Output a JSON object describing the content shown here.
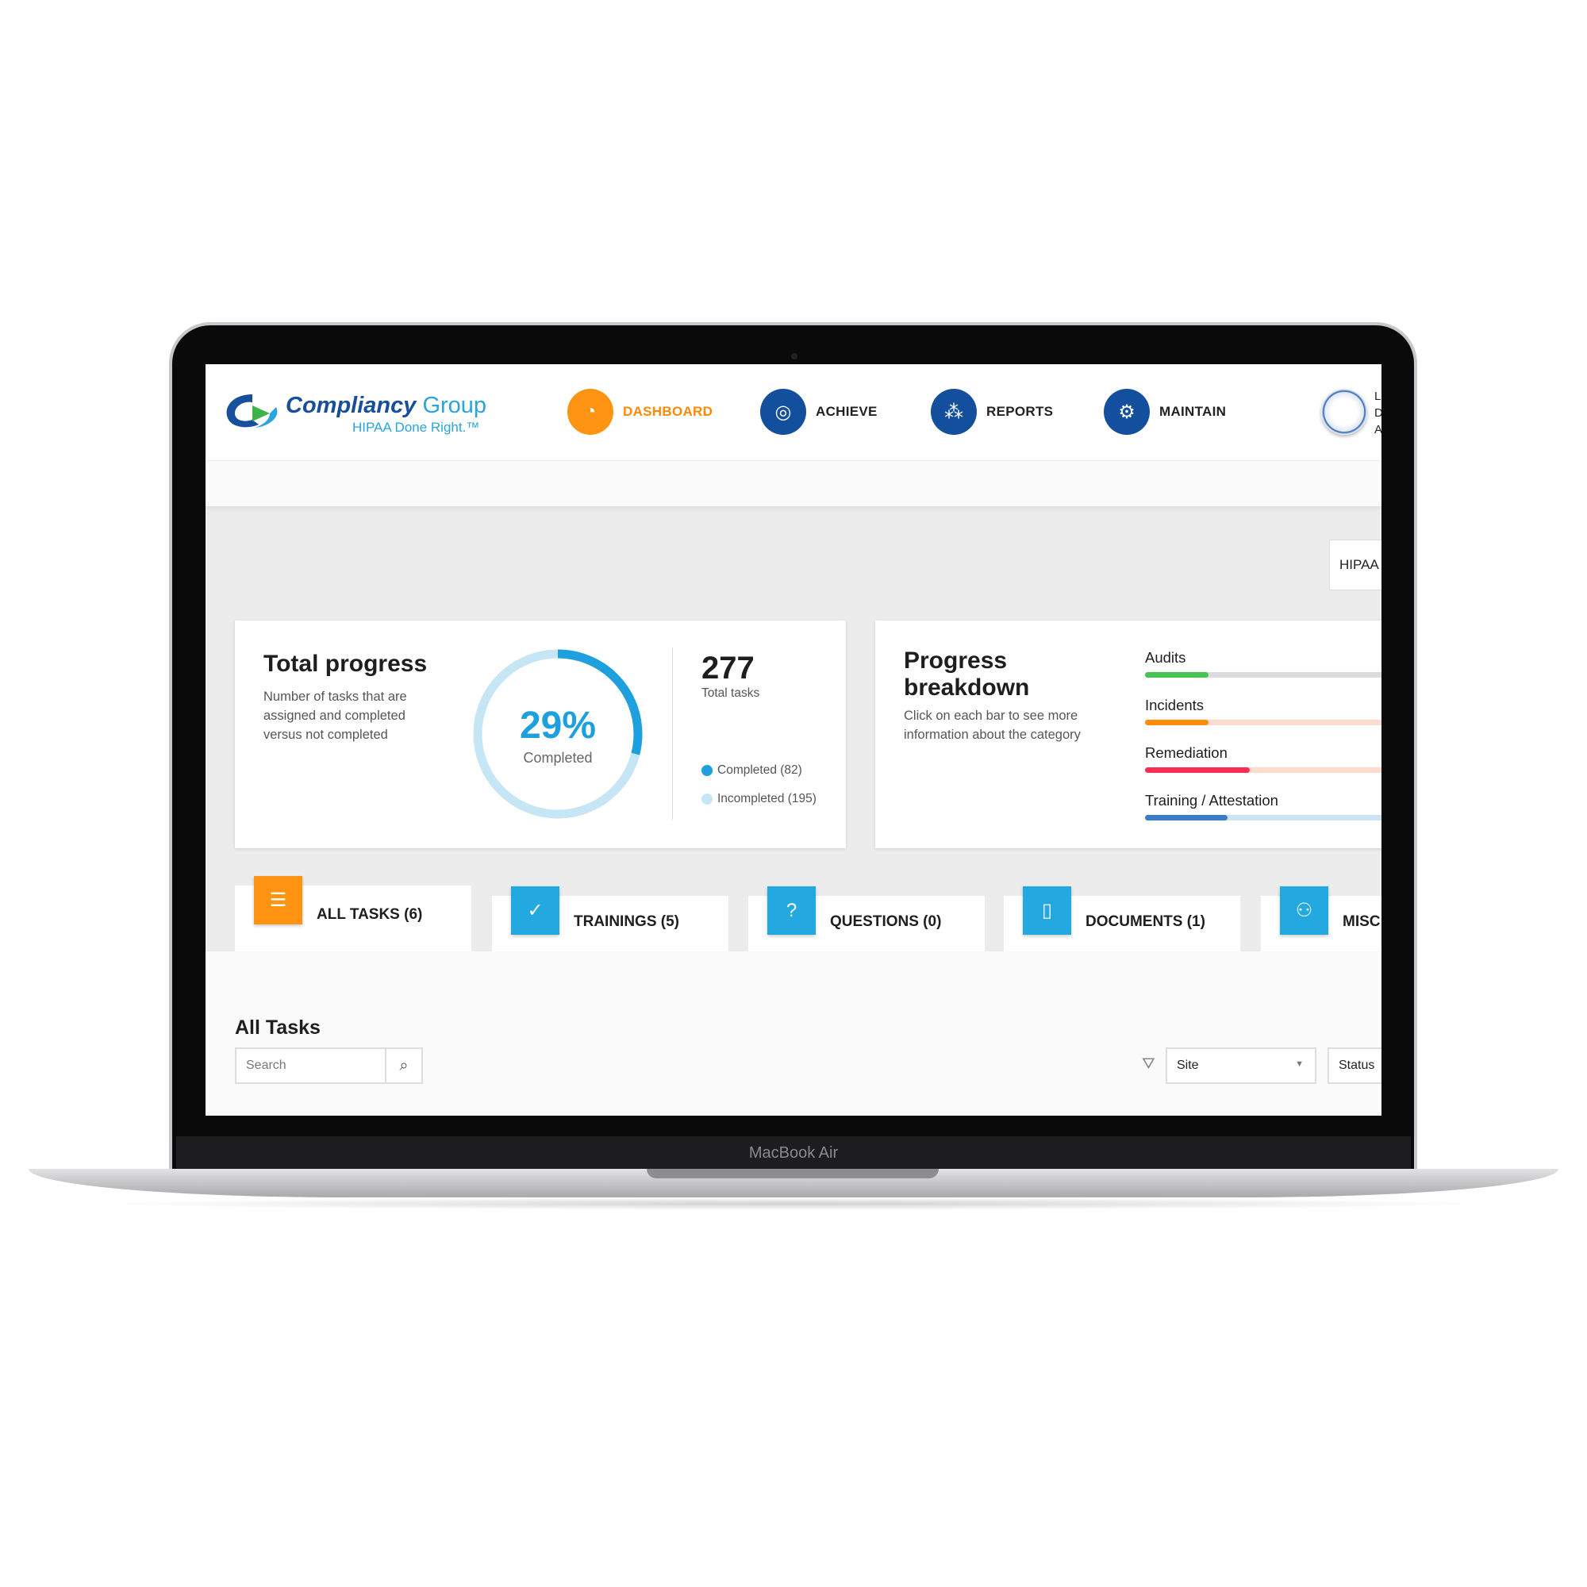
{
  "device": {
    "label": "MacBook Air"
  },
  "header": {
    "logo": {
      "name_bold": "Compliancy",
      "name_light": "Group",
      "tagline": "HIPAA Done Right.™"
    },
    "nav": [
      {
        "label": "DASHBOARD",
        "icon": "gauge-icon",
        "active": true
      },
      {
        "label": "ACHIEVE",
        "icon": "target-icon",
        "active": false
      },
      {
        "label": "REPORTS",
        "icon": "hierarchy-icon",
        "active": false
      },
      {
        "label": "MAINTAIN",
        "icon": "gears-icon",
        "active": false
      }
    ],
    "user": {
      "line1": "L",
      "line2": "D",
      "line3": "A"
    }
  },
  "program_button": "HIPAA",
  "total_progress": {
    "title": "Total progress",
    "description": "Number of tasks that are assigned and completed versus not completed",
    "percent": 29,
    "percent_label": "29%",
    "percent_caption": "Completed",
    "total": "277",
    "total_label": "Total tasks",
    "legend": [
      {
        "label": "Completed (82)",
        "color": "#1ea0de"
      },
      {
        "label": "Incompleted (195)",
        "color": "#c6e6f6"
      }
    ]
  },
  "progress_breakdown": {
    "title_line1": "Progress",
    "title_line2": "breakdown",
    "description": "Click on each bar to see more information about the category",
    "bars": [
      {
        "label": "Audits",
        "fill": 0.2,
        "color": "#46c352",
        "track": "#dcdcdc"
      },
      {
        "label": "Incidents",
        "fill": 0.2,
        "color": "#ff8c0a",
        "track": "#fddcd0"
      },
      {
        "label": "Remediation",
        "fill": 0.33,
        "color": "#ff2d55",
        "track": "#fddcd0"
      },
      {
        "label": "Training / Attestation",
        "fill": 0.26,
        "color": "#3a7cc8",
        "track": "#cde3f3"
      }
    ]
  },
  "tabs": [
    {
      "label": "ALL TASKS (6)",
      "icon": "list-icon",
      "active": true
    },
    {
      "label": "TRAININGS (5)",
      "icon": "badge-check-icon",
      "active": false
    },
    {
      "label": "QUESTIONS (0)",
      "icon": "question-icon",
      "active": false
    },
    {
      "label": "DOCUMENTS (1)",
      "icon": "document-icon",
      "active": false
    },
    {
      "label": "MISC",
      "icon": "user-gear-icon",
      "active": false
    }
  ],
  "tasks": {
    "title": "All Tasks",
    "search_placeholder": "Search",
    "site_select": "Site",
    "status_select": "Status"
  }
}
